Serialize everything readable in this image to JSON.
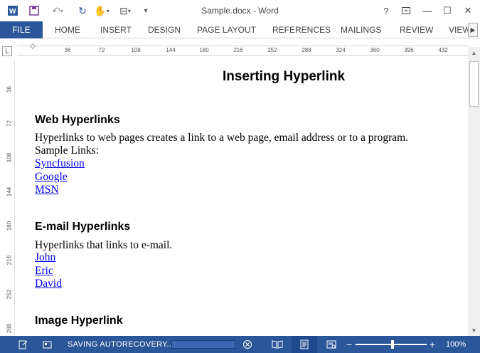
{
  "titlebar": {
    "title": "Sample.docx - Word",
    "help": "?",
    "minimize": "—",
    "restore": "☐",
    "close": "✕"
  },
  "ribbon": {
    "file": "FILE",
    "tabs": [
      "HOME",
      "INSERT",
      "DESIGN",
      "PAGE LAYOUT",
      "REFERENCES",
      "MAILINGS",
      "REVIEW",
      "VIEW"
    ]
  },
  "ruler": {
    "h_ticks": [
      "36",
      "72",
      "108",
      "144",
      "180",
      "216",
      "252",
      "288",
      "324",
      "360",
      "396",
      "432"
    ],
    "v_ticks": [
      "36",
      "72",
      "108",
      "144",
      "180",
      "216",
      "252",
      "288"
    ]
  },
  "document": {
    "title": "Inserting Hyperlink",
    "sections": [
      {
        "heading": "Web Hyperlinks",
        "lines": [
          "Hyperlinks to web pages creates a link to a web page, email address or to a program.",
          "Sample Links:"
        ],
        "links": [
          "Syncfusion",
          "Google",
          "MSN"
        ]
      },
      {
        "heading": "E-mail Hyperlinks",
        "lines": [
          "Hyperlinks that links to e-mail."
        ],
        "links": [
          "John",
          "Eric",
          "David"
        ]
      },
      {
        "heading": "Image Hyperlink",
        "lines": [],
        "links": []
      }
    ]
  },
  "statusbar": {
    "status": "SAVING AUTORECOVERY...",
    "zoom": "100%",
    "zoom_minus": "−",
    "zoom_plus": "+"
  },
  "colors": {
    "accent": "#2b579a",
    "link": "#0000ee"
  }
}
